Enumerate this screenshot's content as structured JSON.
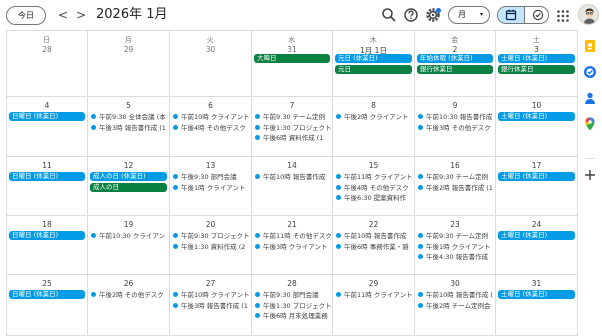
{
  "header": {
    "today_label": "今日",
    "prev_label": "<",
    "next_label": ">",
    "month_title": "2026年 1月",
    "view_label": "月",
    "view_chevron": "▾"
  },
  "weekdays": [
    "日",
    "月",
    "火",
    "水",
    "木",
    "金",
    "土"
  ],
  "weeks": [
    {
      "days": [
        {
          "num": "28",
          "other": true
        },
        {
          "num": "29",
          "other": true
        },
        {
          "num": "30",
          "other": true
        },
        {
          "num": "31",
          "other": true
        },
        {
          "num": "1月 1日",
          "other": false
        },
        {
          "num": "2",
          "other": false
        },
        {
          "num": "3",
          "other": false
        }
      ],
      "allday": [
        {
          "start": 3,
          "span": 1,
          "lane": 0,
          "label": "大晦日",
          "color": "green"
        },
        {
          "start": 4,
          "span": 1,
          "lane": 0,
          "label": "元日 (休業日)",
          "color": "blue"
        },
        {
          "start": 4,
          "span": 1,
          "lane": 1,
          "label": "元日",
          "color": "green"
        },
        {
          "start": 5,
          "span": 1,
          "lane": 0,
          "label": "年始休暇 (休業日)",
          "color": "blue"
        },
        {
          "start": 5,
          "span": 1,
          "lane": 1,
          "label": "銀行休業日",
          "color": "green"
        },
        {
          "start": 6,
          "span": 1,
          "lane": 0,
          "label": "土曜日 (休業日)",
          "color": "blue"
        },
        {
          "start": 6,
          "span": 1,
          "lane": 1,
          "label": "銀行休業日",
          "color": "green"
        }
      ],
      "events": []
    },
    {
      "days": [
        {
          "num": "4",
          "other": false
        },
        {
          "num": "5",
          "other": false
        },
        {
          "num": "6",
          "other": false
        },
        {
          "num": "7",
          "other": false
        },
        {
          "num": "8",
          "other": false
        },
        {
          "num": "9",
          "other": false
        },
        {
          "num": "10",
          "other": false
        }
      ],
      "allday": [
        {
          "start": 0,
          "span": 1,
          "lane": 0,
          "label": "日曜日 (休業日)",
          "color": "blue"
        },
        {
          "start": 6,
          "span": 1,
          "lane": 0,
          "label": "土曜日 (休業日)",
          "color": "blue"
        }
      ],
      "events": [
        {
          "day": 1,
          "row": 0,
          "label": "午前9:30 全体会議 (本"
        },
        {
          "day": 1,
          "row": 1,
          "label": "午後3時 報告書作成 (1"
        },
        {
          "day": 2,
          "row": 0,
          "label": "午前10時 クライアント"
        },
        {
          "day": 2,
          "row": 1,
          "label": "午後4時 その他デスク"
        },
        {
          "day": 3,
          "row": 0,
          "label": "午前9:30 チーム定例"
        },
        {
          "day": 3,
          "row": 1,
          "label": "午後1:30 プロジェクト"
        },
        {
          "day": 3,
          "row": 2,
          "label": "午後6時 資料作成 (1"
        },
        {
          "day": 4,
          "row": 0,
          "label": "午後2時 クライアント"
        },
        {
          "day": 5,
          "row": 0,
          "label": "午前10:30 報告書作成"
        },
        {
          "day": 5,
          "row": 1,
          "label": "午後3時 その他デスク"
        }
      ]
    },
    {
      "days": [
        {
          "num": "11",
          "other": false
        },
        {
          "num": "12",
          "other": false
        },
        {
          "num": "13",
          "other": false
        },
        {
          "num": "14",
          "other": false
        },
        {
          "num": "15",
          "other": false
        },
        {
          "num": "16",
          "other": false
        },
        {
          "num": "17",
          "other": false
        }
      ],
      "allday": [
        {
          "start": 0,
          "span": 1,
          "lane": 0,
          "label": "日曜日 (休業日)",
          "color": "blue"
        },
        {
          "start": 1,
          "span": 1,
          "lane": 0,
          "label": "成人の日 (休業日)",
          "color": "blue"
        },
        {
          "start": 1,
          "span": 1,
          "lane": 1,
          "label": "成人の日",
          "color": "green"
        },
        {
          "start": 6,
          "span": 1,
          "lane": 0,
          "label": "土曜日 (休業日)",
          "color": "blue"
        }
      ],
      "events": [
        {
          "day": 2,
          "row": 0,
          "label": "午後9:30 部門会議"
        },
        {
          "day": 2,
          "row": 1,
          "label": "午後1時 クライアント"
        },
        {
          "day": 3,
          "row": 0,
          "label": "午前10時 報告書作成"
        },
        {
          "day": 4,
          "row": 0,
          "label": "午前11時 クライアント"
        },
        {
          "day": 4,
          "row": 1,
          "label": "午後4時 その他デスク"
        },
        {
          "day": 4,
          "row": 2,
          "label": "午後6:30 提案資料作"
        },
        {
          "day": 5,
          "row": 0,
          "label": "午前9:30 チーム定例"
        },
        {
          "day": 5,
          "row": 1,
          "label": "午後2時 報告書作成 (1"
        }
      ]
    },
    {
      "days": [
        {
          "num": "18",
          "other": false
        },
        {
          "num": "19",
          "other": false
        },
        {
          "num": "20",
          "other": false
        },
        {
          "num": "21",
          "other": false
        },
        {
          "num": "22",
          "other": false
        },
        {
          "num": "23",
          "other": false
        },
        {
          "num": "24",
          "other": false
        }
      ],
      "allday": [
        {
          "start": 0,
          "span": 1,
          "lane": 0,
          "label": "日曜日 (休業日)",
          "color": "blue"
        },
        {
          "start": 6,
          "span": 1,
          "lane": 0,
          "label": "土曜日 (休業日)",
          "color": "blue"
        }
      ],
      "events": [
        {
          "day": 1,
          "row": 0,
          "label": "午前10:30 クライアン"
        },
        {
          "day": 2,
          "row": 0,
          "label": "午前9:30 プロジェクト"
        },
        {
          "day": 2,
          "row": 1,
          "label": "午後1:30 資料作成 (2"
        },
        {
          "day": 3,
          "row": 0,
          "label": "午前11時 その他デスク"
        },
        {
          "day": 3,
          "row": 1,
          "label": "午後3時 クライアント"
        },
        {
          "day": 4,
          "row": 0,
          "label": "午前10時 報告書作成"
        },
        {
          "day": 4,
          "row": 1,
          "label": "午後6時 事務作業・雑"
        },
        {
          "day": 5,
          "row": 0,
          "label": "午前9:30 チーム定例"
        },
        {
          "day": 5,
          "row": 1,
          "label": "午後1時 クライアント"
        },
        {
          "day": 5,
          "row": 2,
          "label": "午後4:30 報告書作成"
        }
      ]
    },
    {
      "days": [
        {
          "num": "25",
          "other": false
        },
        {
          "num": "26",
          "other": false
        },
        {
          "num": "27",
          "other": false
        },
        {
          "num": "28",
          "other": false
        },
        {
          "num": "29",
          "other": false
        },
        {
          "num": "30",
          "other": false
        },
        {
          "num": "31",
          "other": false
        }
      ],
      "allday": [
        {
          "start": 0,
          "span": 1,
          "lane": 0,
          "label": "日曜日 (休業日)",
          "color": "blue"
        },
        {
          "start": 6,
          "span": 1,
          "lane": 0,
          "label": "土曜日 (休業日)",
          "color": "blue"
        }
      ],
      "events": [
        {
          "day": 1,
          "row": 0,
          "label": "午後2時 その他デスク"
        },
        {
          "day": 2,
          "row": 0,
          "label": "午前10時 クライアント"
        },
        {
          "day": 2,
          "row": 1,
          "label": "午後3時 報告書作成 (1"
        },
        {
          "day": 3,
          "row": 0,
          "label": "午前9:30 部門会議"
        },
        {
          "day": 3,
          "row": 1,
          "label": "午後1:30 プロジェクト"
        },
        {
          "day": 3,
          "row": 2,
          "label": "午後6時 月末処理業務"
        },
        {
          "day": 4,
          "row": 0,
          "label": "午前11時 クライアント"
        },
        {
          "day": 5,
          "row": 0,
          "label": "午前10時 報告書作成 ("
        },
        {
          "day": 5,
          "row": 1,
          "label": "午後2時 チーム定例会"
        }
      ]
    }
  ],
  "colors": {
    "holiday_blue": "#039be5",
    "holiday_green": "#0b8043",
    "accent": "#1a73e8",
    "selected_view_bg": "#c2e7ff"
  },
  "side_panel_icons": [
    "keep-icon",
    "tasks-icon",
    "contacts-icon",
    "maps-icon",
    "add-icon"
  ]
}
